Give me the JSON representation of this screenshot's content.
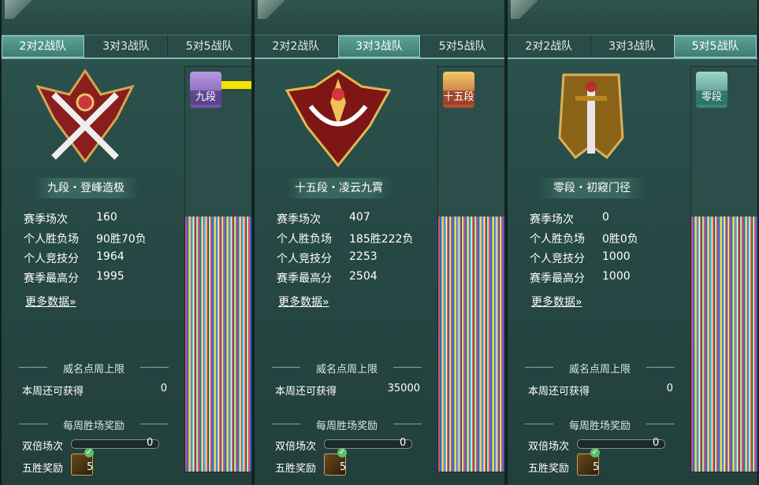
{
  "panels": [
    {
      "tabs": [
        "2对2战队",
        "3对3战队",
        "5对5战队"
      ],
      "active_tab": 0,
      "rank_badge": "九段",
      "title": "九段・登峰造极",
      "stats": [
        {
          "label": "赛季场次",
          "value": "160"
        },
        {
          "label": "个人胜负场",
          "value": "90胜70负"
        },
        {
          "label": "个人竞技分",
          "value": "1964"
        },
        {
          "label": "赛季最高分",
          "value": "1995"
        }
      ],
      "more_data": "更多数据»",
      "fame_section": "威名点周上限",
      "week_label": "本周还可获得",
      "week_value": "0",
      "weekly_section": "每周胜场奖励",
      "double_label": "双倍场次",
      "double_value": "0",
      "five_win_label": "五胜奖励",
      "five_win_count": "5"
    },
    {
      "tabs": [
        "2对2战队",
        "3对3战队",
        "5对5战队"
      ],
      "active_tab": 1,
      "rank_badge": "十五段",
      "title": "十五段・凌云九霄",
      "stats": [
        {
          "label": "赛季场次",
          "value": "407"
        },
        {
          "label": "个人胜负场",
          "value": "185胜222负"
        },
        {
          "label": "个人竞技分",
          "value": "2253"
        },
        {
          "label": "赛季最高分",
          "value": "2504"
        }
      ],
      "more_data": "更多数据»",
      "fame_section": "威名点周上限",
      "week_label": "本周还可获得",
      "week_value": "35000",
      "weekly_section": "每周胜场奖励",
      "double_label": "双倍场次",
      "double_value": "0",
      "five_win_label": "五胜奖励",
      "five_win_count": "5"
    },
    {
      "tabs": [
        "2对2战队",
        "3对3战队",
        "5对5战队"
      ],
      "active_tab": 2,
      "rank_badge": "零段",
      "title": "零段・初窥门径",
      "stats": [
        {
          "label": "赛季场次",
          "value": "0"
        },
        {
          "label": "个人胜负场",
          "value": "0胜0负"
        },
        {
          "label": "个人竞技分",
          "value": "1000"
        },
        {
          "label": "赛季最高分",
          "value": "1000"
        }
      ],
      "more_data": "更多数据»",
      "fame_section": "威名点周上限",
      "week_label": "本周还可获得",
      "week_value": "0",
      "weekly_section": "每周胜场奖励",
      "double_label": "双倍场次",
      "double_value": "0",
      "five_win_label": "五胜奖励",
      "five_win_count": "5"
    }
  ],
  "colors": {
    "panel_bg": "#274a46",
    "tab_active": "#5fa39a",
    "highlight_yellow": "#f3e300"
  },
  "icons": [
    "emblem-crossed-swords-icon",
    "emblem-winged-crown-icon",
    "emblem-sword-banner-icon",
    "reward-chest-icon",
    "check-icon"
  ]
}
